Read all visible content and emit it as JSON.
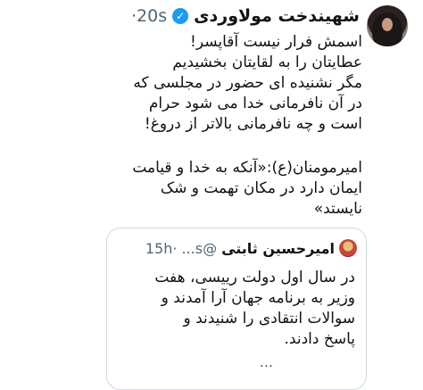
{
  "author": {
    "name": "شهیندخت مولاوردی",
    "time": "·20s"
  },
  "tweet": {
    "lines": [
      "اسمش فرار نیست آقاپسر!",
      "عطایتان را به لقایتان بخشیدیم",
      "مگر نشنیده ای حضور در مجلسی که",
      "در آن نافرمانی خدا می شود حرام",
      "است و چه نافرمانی بالاتر از دروغ!"
    ],
    "lines2": [
      "امیرمومنان(ع):«آنکه به خدا و قیامت",
      "ایمان دارد در مکان تهمت و شک",
      "نایستد»"
    ]
  },
  "quote": {
    "name": "امیرحسین ثابتی",
    "handle": "@s...",
    "time": "·15h",
    "lines": [
      "در سال اول دولت رییسی، هفت",
      "وزیر به برنامه جهان آرا آمدند و",
      "سوالات انتقادی را شنیدند و",
      "پاسخ دادند."
    ],
    "more": "..."
  },
  "icons": {
    "verified": "verified-badge-icon",
    "verified_color": "#1d9bf0"
  }
}
